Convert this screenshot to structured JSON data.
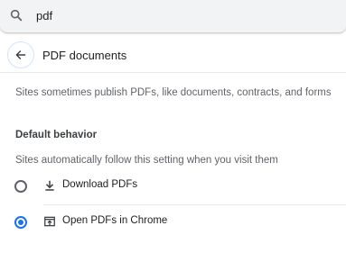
{
  "search": {
    "value": "pdf"
  },
  "header": {
    "title": "PDF documents",
    "back_icon": "arrow-left-icon"
  },
  "description": "Sites sometimes publish PDFs, like documents, contracts, and forms",
  "default_behavior": {
    "heading": "Default behavior",
    "subtext": "Sites automatically follow this setting when you visit them",
    "options": [
      {
        "label": "Download PDFs",
        "icon": "download-icon",
        "selected": false
      },
      {
        "label": "Open PDFs in Chrome",
        "icon": "open-in-browser-icon",
        "selected": true
      }
    ]
  },
  "colors": {
    "accent": "#1a73e8",
    "search_background": "#f1f3f4",
    "secondary_text": "#5f6368"
  }
}
